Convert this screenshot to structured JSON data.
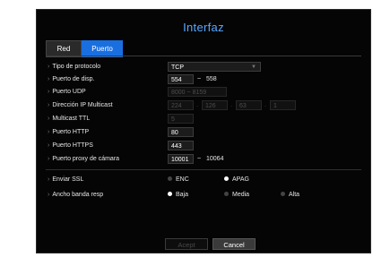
{
  "title": "Interfaz",
  "tabs": [
    {
      "label": "Red"
    },
    {
      "label": "Puerto"
    }
  ],
  "rows": {
    "protocol": {
      "label": "Tipo de protocolo",
      "value": "TCP"
    },
    "device_port": {
      "label": "Puerto de disp.",
      "from": "554",
      "sep": "~",
      "to": "558"
    },
    "udp_port": {
      "label": "Puerto UDP",
      "from": "8000",
      "sep": "~",
      "to": "8159"
    },
    "multicast_ip": {
      "label": "Dirección IP Multicast",
      "octets": [
        "224",
        "126",
        "63",
        "1"
      ],
      "dot": "."
    },
    "multicast_ttl": {
      "label": "Multicast TTL",
      "value": "5"
    },
    "http_port": {
      "label": "Puerto HTTP",
      "value": "80"
    },
    "https_port": {
      "label": "Puerto HTTPS",
      "value": "443"
    },
    "camera_proxy": {
      "label": "Puerto proxy de cámara",
      "from": "10001",
      "sep": "~",
      "to": "10064"
    }
  },
  "ssl": {
    "label": "Enviar SSL",
    "options": [
      "ENC",
      "APAG"
    ],
    "selected": "APAG"
  },
  "bandwidth": {
    "label": "Ancho banda resp",
    "options": [
      "Baja",
      "Media",
      "Alta"
    ],
    "selected": "Baja"
  },
  "buttons": {
    "accept": "Acept",
    "cancel": "Cancel"
  },
  "icons": {
    "select_arrow": "chevron-down-icon"
  },
  "colors": {
    "accent": "#1a6fe0",
    "title": "#5aa7ff",
    "background": "#050505"
  }
}
